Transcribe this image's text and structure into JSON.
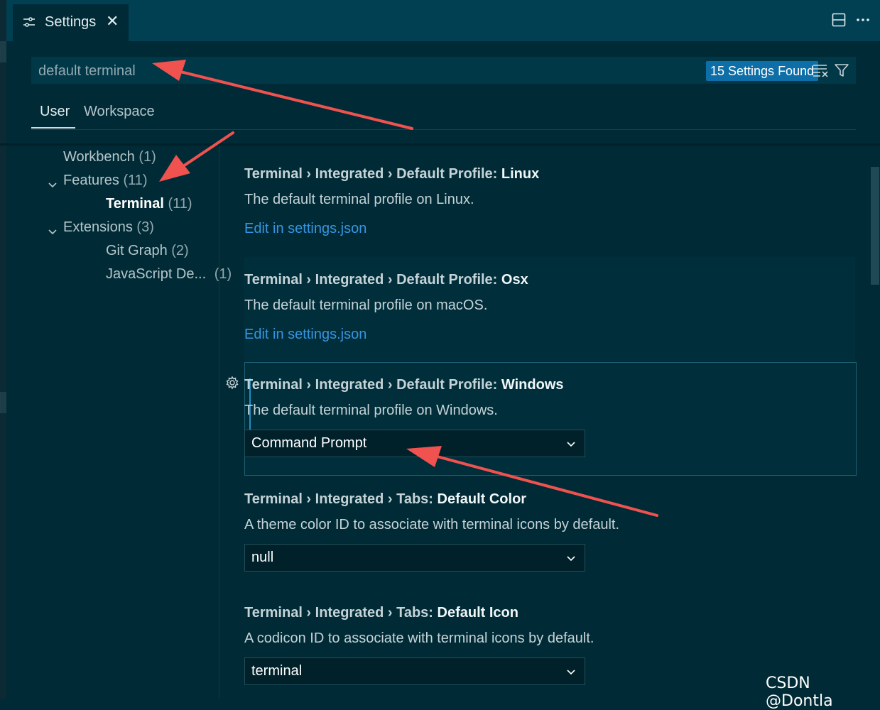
{
  "tab": {
    "title": "Settings",
    "close_glyph": "✕",
    "icon": "settings-sliders-icon"
  },
  "header_actions": [
    "split-editor-icon",
    "more-actions-icon"
  ],
  "search": {
    "value": "default terminal",
    "results_badge": "15 Settings Found",
    "icons": [
      "clear-filter-icon",
      "filter-icon"
    ]
  },
  "scope_tabs": {
    "user": "User",
    "workspace": "Workspace",
    "active": "User"
  },
  "tree": [
    {
      "name": "Workbench",
      "count": "(1)",
      "expanded": null,
      "selected": false
    },
    {
      "name": "Features",
      "count": "(11)",
      "expanded": true,
      "selected": false
    },
    {
      "name": "Terminal",
      "count": "(11)",
      "expanded": null,
      "selected": true
    },
    {
      "name": "Extensions",
      "count": "(3)",
      "expanded": true,
      "selected": false
    },
    {
      "name": "Git Graph",
      "count": "(2)",
      "expanded": null,
      "selected": false
    },
    {
      "name": "JavaScript De...",
      "count": "(1)",
      "expanded": null,
      "selected": false
    }
  ],
  "settings": [
    {
      "prefix": "Terminal › Integrated › Default Profile: ",
      "key": "Linux",
      "description": "The default terminal profile on Linux.",
      "link": "Edit in settings.json"
    },
    {
      "prefix": "Terminal › Integrated › Default Profile: ",
      "key": "Osx",
      "description": "The default terminal profile on macOS.",
      "link": "Edit in settings.json"
    },
    {
      "prefix": "Terminal › Integrated › Default Profile: ",
      "key": "Windows",
      "description": "The default terminal profile on Windows.",
      "select_value": "Command Prompt"
    },
    {
      "prefix": "Terminal › Integrated › Tabs: ",
      "key": "Default Color",
      "description": "A theme color ID to associate with terminal icons by default.",
      "select_value": "null"
    },
    {
      "prefix": "Terminal › Integrated › Tabs: ",
      "key": "Default Icon",
      "description": "A codicon ID to associate with terminal icons by default.",
      "select_value": "terminal"
    }
  ],
  "watermark": "CSDN @Dontla",
  "colors": {
    "background": "#002b36",
    "accent_link": "#3794e0",
    "badge": "#0e6ea8",
    "annotation_arrow": "#f0524f"
  }
}
